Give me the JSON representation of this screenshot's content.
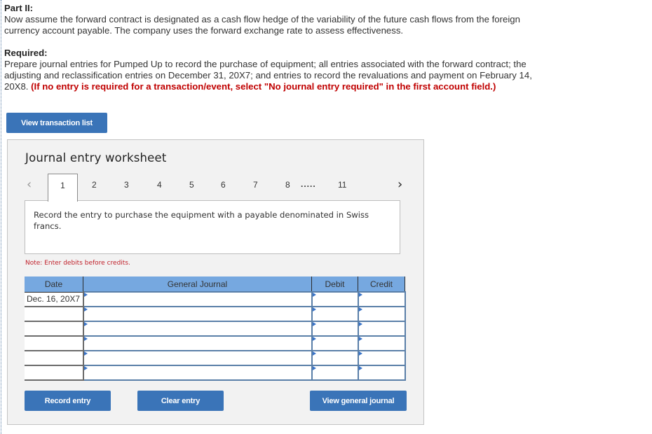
{
  "intro": {
    "part_heading": "Part II:",
    "part_text_line1": "Now assume the forward contract is designated as a cash flow hedge of the variability of the future cash flows from the foreign",
    "part_text_line2": "currency account payable. The company uses the forward exchange rate to assess effectiveness.",
    "required_heading": "Required:",
    "required_line1": "Prepare journal entries for Pumped Up to record the purchase of equipment; all entries associated with the forward contract; the",
    "required_line2": "adjusting and reclassification entries on December 31, 20X7; and entries to record the revaluations and payment on February 14,",
    "required_line3_prefix": "20X8. ",
    "required_instruction": "(If no entry is required for a transaction/event, select \"No journal entry required\" in the first account field.)"
  },
  "buttons": {
    "view_transaction_list": "View transaction list",
    "record_entry": "Record entry",
    "clear_entry": "Clear entry",
    "view_general_journal": "View general journal"
  },
  "worksheet": {
    "title": "Journal entry worksheet",
    "pager": {
      "prev_icon": "‹",
      "next_icon": "›",
      "pages": [
        "1",
        "2",
        "3",
        "4",
        "5",
        "6",
        "7",
        "8",
        "11"
      ],
      "active_page": "1",
      "ellipsis": "....."
    },
    "description": "Record the entry to purchase the equipment with a payable denominated in Swiss francs.",
    "note": "Note: Enter debits before credits.",
    "table": {
      "headers": {
        "date": "Date",
        "journal": "General Journal",
        "debit": "Debit",
        "credit": "Credit"
      },
      "rows": [
        {
          "date": "Dec. 16, 20X7",
          "account": "",
          "debit": "",
          "credit": ""
        },
        {
          "date": "",
          "account": "",
          "debit": "",
          "credit": ""
        },
        {
          "date": "",
          "account": "",
          "debit": "",
          "credit": ""
        },
        {
          "date": "",
          "account": "",
          "debit": "",
          "credit": ""
        },
        {
          "date": "",
          "account": "",
          "debit": "",
          "credit": ""
        },
        {
          "date": "",
          "account": "",
          "debit": "",
          "credit": ""
        }
      ]
    }
  }
}
